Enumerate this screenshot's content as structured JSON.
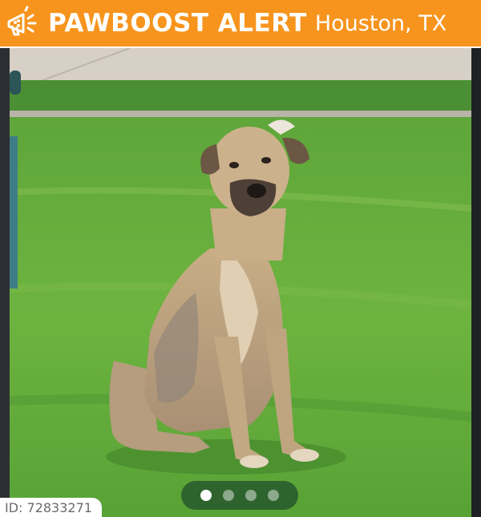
{
  "header": {
    "brand_text": "PAWBOOST ALERT",
    "location": "Houston, TX",
    "logo_icon": "megaphone-paw-icon",
    "bar_color": "#f7941d"
  },
  "photo": {
    "subject": "dog-photo",
    "carousel": {
      "total_slides": 4,
      "active_index": 0
    }
  },
  "footer": {
    "id_label": "ID: 72833271"
  }
}
